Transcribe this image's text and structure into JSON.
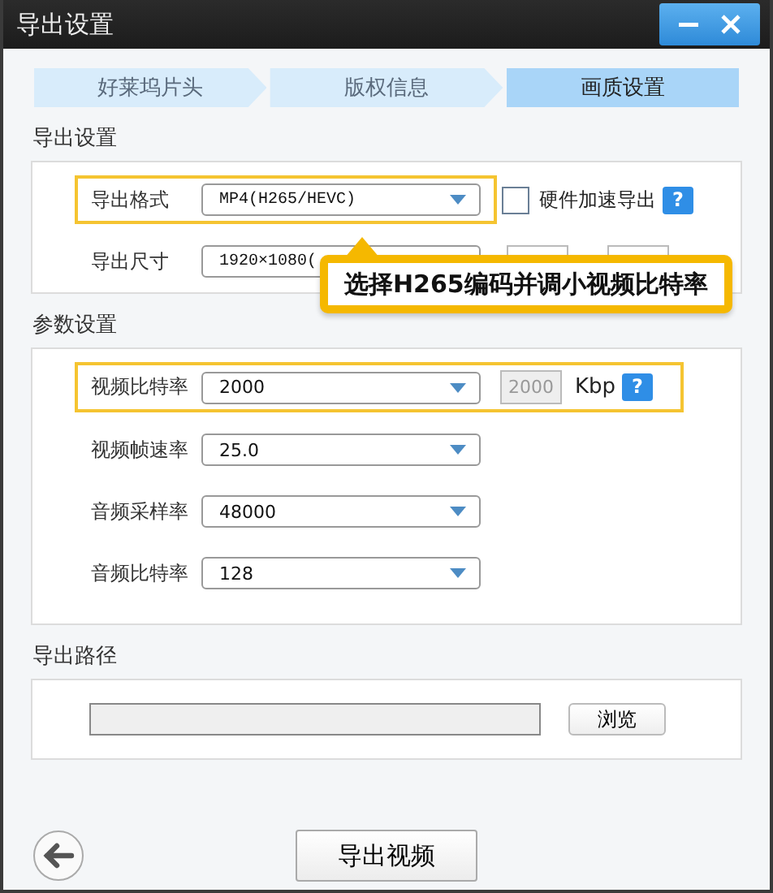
{
  "window": {
    "title": "导出设置"
  },
  "steps": [
    {
      "label": "好莱坞片头",
      "selected": false
    },
    {
      "label": "版权信息",
      "selected": false
    },
    {
      "label": "画质设置",
      "selected": true
    }
  ],
  "export_settings": {
    "title": "导出设置",
    "format": {
      "label": "导出格式",
      "value": "MP4(H265/HEVC)",
      "highlighted": true
    },
    "hardware_accel": {
      "label": "硬件加速导出",
      "checked": false,
      "help": "?"
    },
    "size": {
      "label": "导出尺寸",
      "value": "1920×1080("
    }
  },
  "callout": {
    "text": "选择H265编码并调小视频比特率"
  },
  "params": {
    "title": "参数设置",
    "rows": [
      {
        "label": "视频比特率",
        "value": "2000",
        "highlighted": true,
        "custom_value": "2000",
        "unit": "Kbp",
        "help": "?"
      },
      {
        "label": "视频帧速率",
        "value": "25.0",
        "highlighted": false
      },
      {
        "label": "音频采样率",
        "value": "48000",
        "highlighted": false
      },
      {
        "label": "音频比特率",
        "value": "128",
        "highlighted": false
      }
    ]
  },
  "output_path": {
    "title": "导出路径",
    "browse": "浏览"
  },
  "export_button": "导出视频"
}
